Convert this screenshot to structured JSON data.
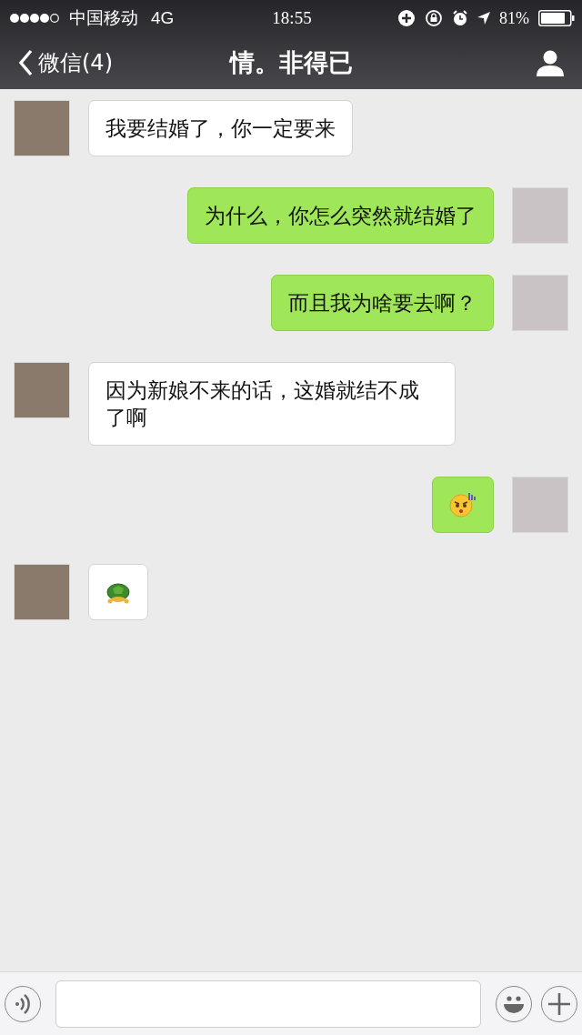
{
  "status_bar": {
    "carrier": "中国移动",
    "network": "4G",
    "time": "18:55",
    "battery": "81%"
  },
  "nav": {
    "back": "微信(4)",
    "title": "情。非得已"
  },
  "messages": [
    {
      "outgoing": false,
      "kind": "text",
      "text": "我要结婚了，你一定要来"
    },
    {
      "outgoing": true,
      "kind": "text",
      "text": "为什么，你怎么突然就结婚了"
    },
    {
      "outgoing": true,
      "kind": "text",
      "text": "而且我为啥要去啊？"
    },
    {
      "outgoing": false,
      "kind": "text",
      "text": "因为新娘不来的话，这婚就结不成了啊"
    },
    {
      "outgoing": true,
      "kind": "face"
    },
    {
      "outgoing": false,
      "kind": "turtle"
    }
  ]
}
